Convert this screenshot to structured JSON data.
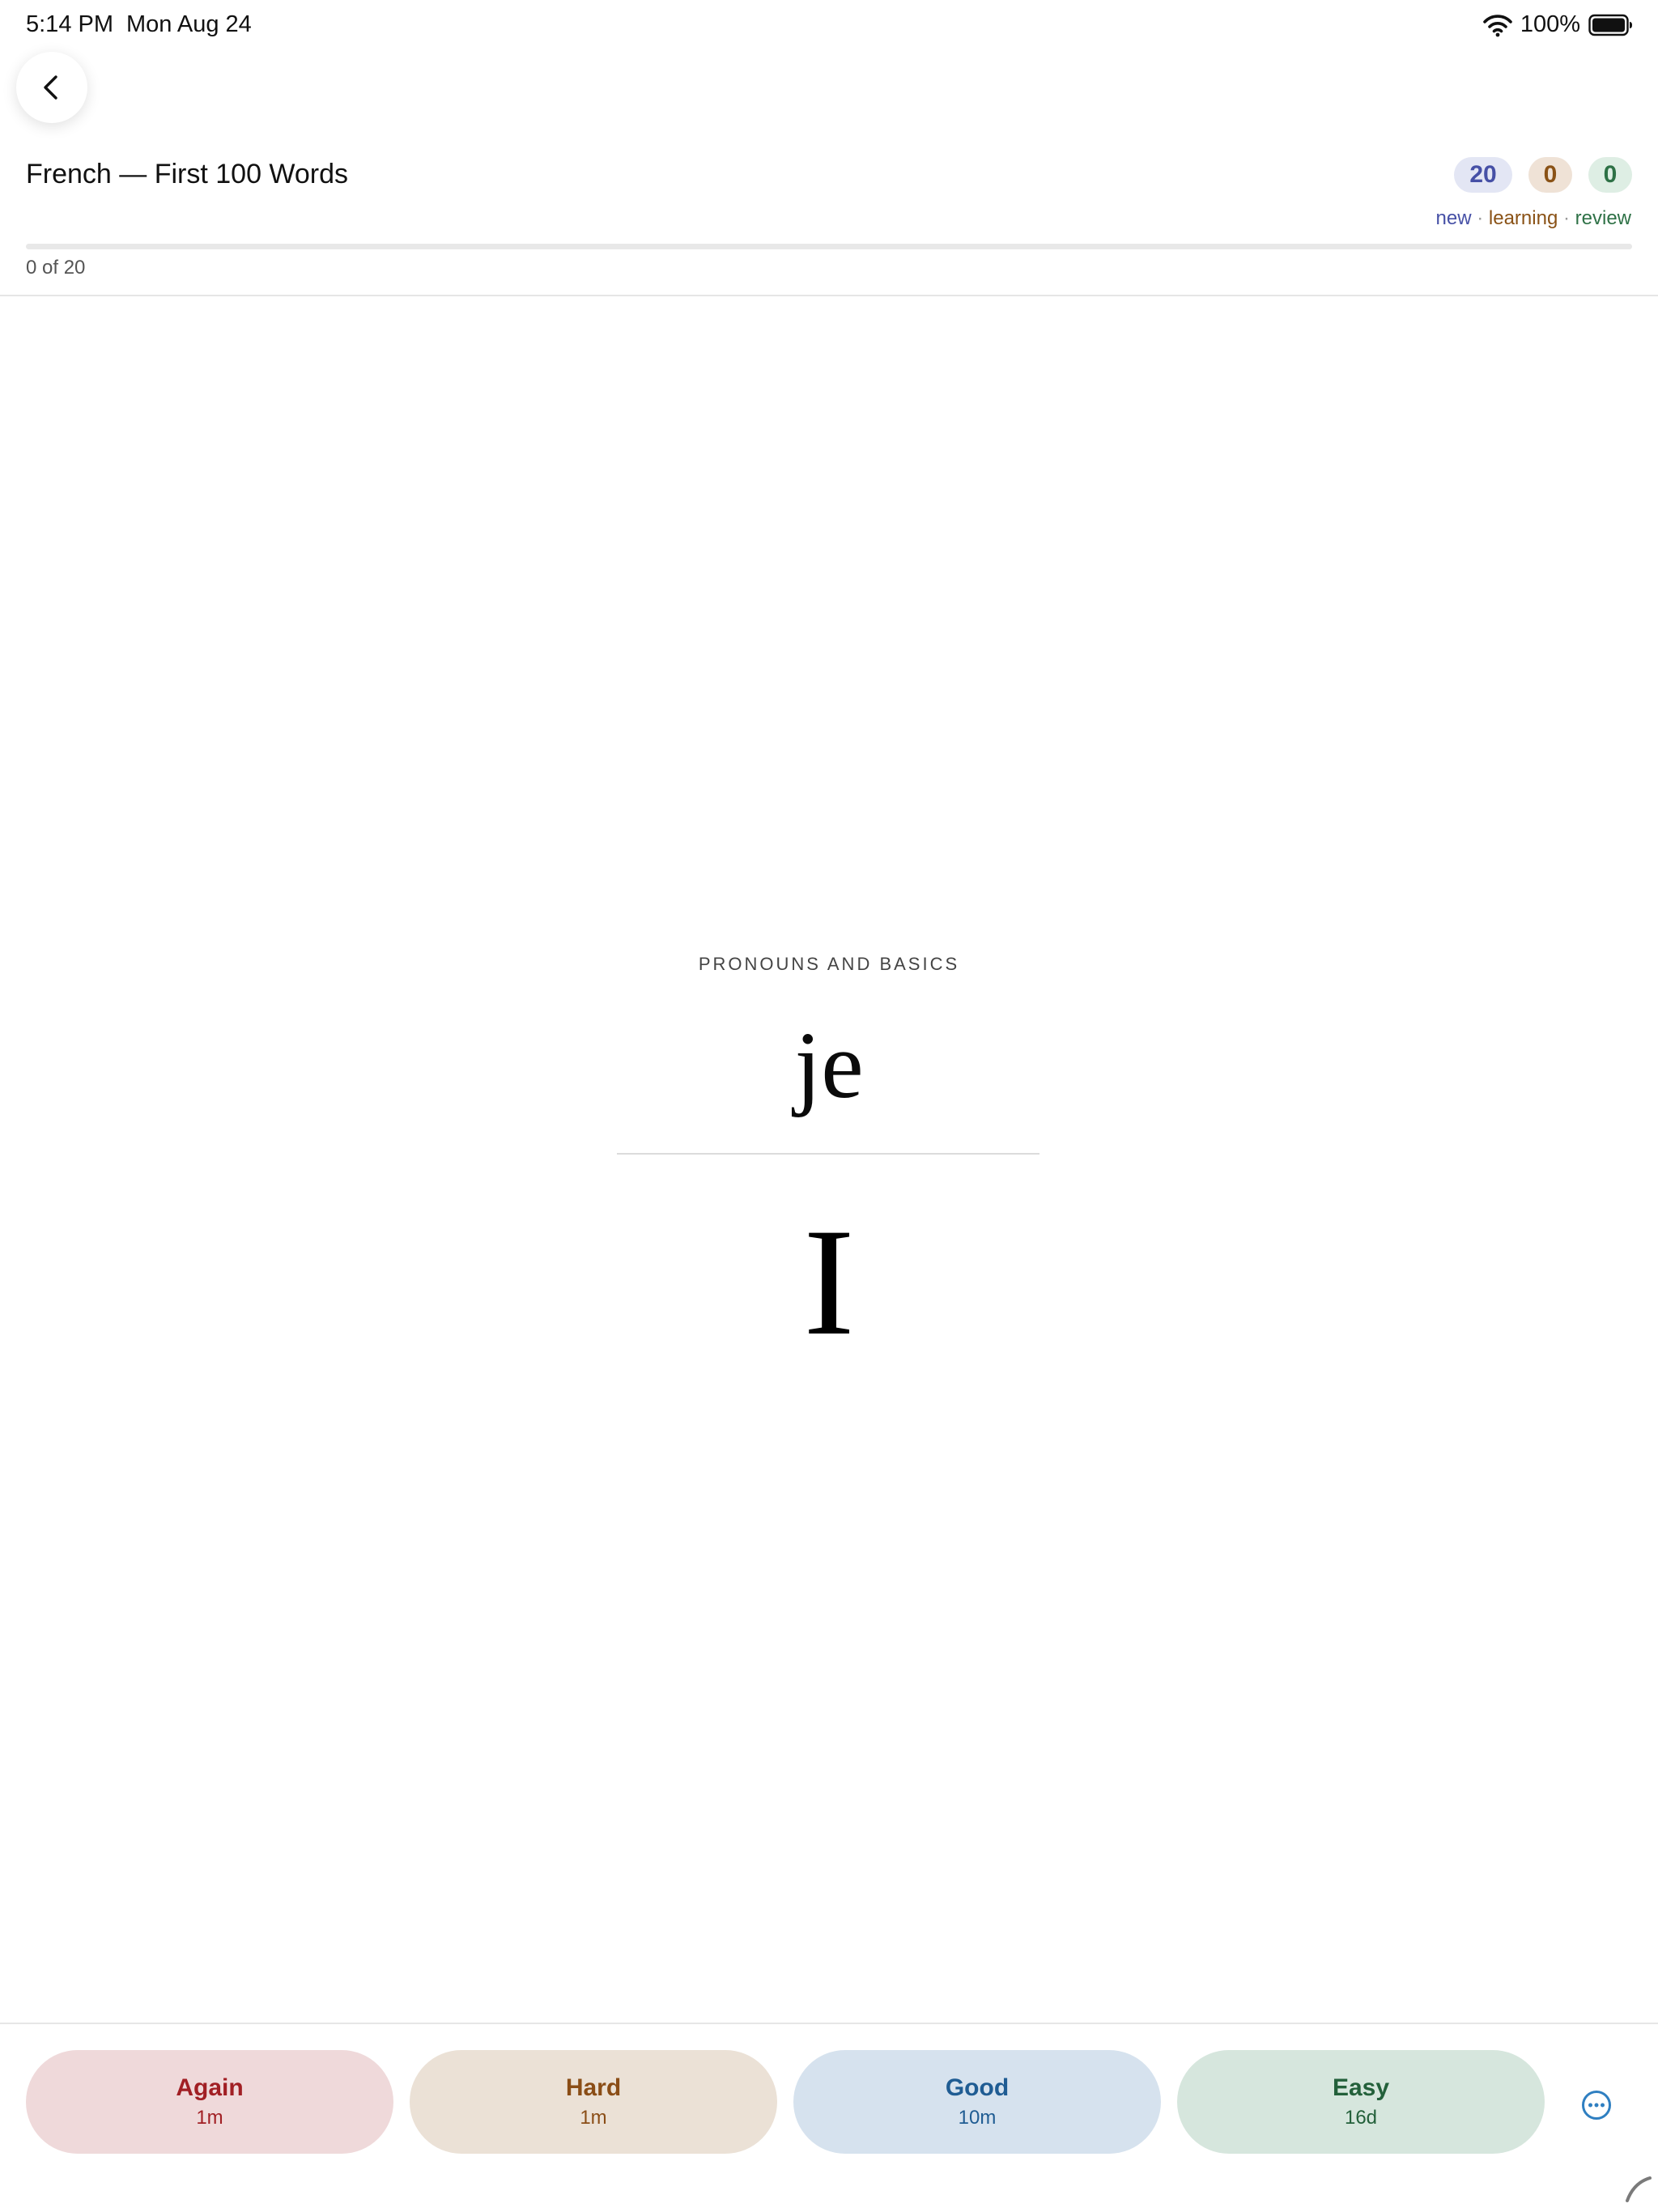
{
  "status_bar": {
    "time": "5:14 PM",
    "date": "Mon Aug 24",
    "battery_percent": "100%",
    "wifi_icon": "wifi-icon",
    "battery_icon": "battery-icon"
  },
  "header": {
    "back_icon": "chevron-left-icon",
    "deck_title": "French — First 100 Words",
    "counts": {
      "new": "20",
      "learning": "0",
      "review": "0"
    },
    "legend": {
      "new": "new",
      "learning": "learning",
      "review": "review",
      "separator": "·"
    },
    "progress": {
      "label": "0 of 20",
      "fraction": 0
    }
  },
  "card": {
    "category": "PRONOUNS AND BASICS",
    "front": "je",
    "back": "I"
  },
  "answers": [
    {
      "label": "Again",
      "interval": "1m"
    },
    {
      "label": "Hard",
      "interval": "1m"
    },
    {
      "label": "Good",
      "interval": "10m"
    },
    {
      "label": "Easy",
      "interval": "16d"
    }
  ],
  "more_icon": "ellipsis-circle-icon",
  "colors": {
    "again": "#a11f24",
    "hard": "#8a4d16",
    "good": "#1f5c93",
    "easy": "#23603a",
    "new": "#4650a6",
    "learning": "#8a5216",
    "review": "#2e7146",
    "more": "#2f7fc1"
  }
}
